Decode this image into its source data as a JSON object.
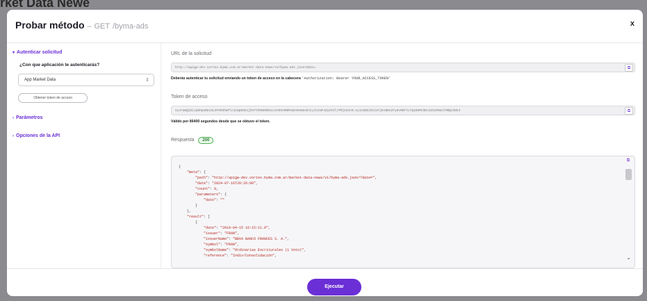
{
  "background": {
    "title": "rket Data Newe"
  },
  "header": {
    "title": "Probar método",
    "separator": "–",
    "method": "GET",
    "path": "/byma-ads",
    "close": "x"
  },
  "sidebar": {
    "auth_label": "Autenticar solicitud",
    "question": "¿Con que aplicación te autenticarás?",
    "app_value": "App Market Data",
    "token_button": "Obtener token de acceso",
    "params_label": "Parámetros",
    "api_options_label": "Opciones de la API"
  },
  "main": {
    "url_label": "URL de la solicitud",
    "url_value": "http://apigw-dev.vortex.byma.com.ar/market-data-news/v1/byma-ads.json?date=",
    "auth_help": "Deberás autenticar tu solicitud enviando un token de acceso en la cabecera",
    "auth_code": "'Authorization: Bearer YOUR_ACCESS_TOKEN'",
    "token_label": "Token de acceso",
    "token_value": "eyJraWQiOiJpbHpaNUJ3LXFOOXhWTlc4LWpDSG1jbVYtRVBXRE5oc2V6SnRNRVdwYmVWenNlcyIsImFsZyI6IlJTMjU2In0.eyJzdWIiOiI4YjExNDA3Yy0xMDFlLTQ4ZmMtODc3ZS1hNmJlMDQzZDk4",
    "token_validity": "Válido por 86400 segundos desde que se obtuvo el token.",
    "response_label": "Respuesta",
    "status_code": "200",
    "run_button": "Ejecutar"
  },
  "response_lines": [
    "{",
    "    \"meta\": {",
    "        \"path\": \"http://apigw-dev.vortex.byma.com.ar/market-data-news/v1/byma-ads.json/?date=\",",
    "        \"date\": \"2024-07-16T20:26:00\",",
    "        \"count\": 9,",
    "        \"parameters\": {",
    "            \"date\": \"\"",
    "        }",
    "    },",
    "    \"result\": [",
    "        {",
    "            \"date\": \"2019-04-15 16:15:11.0\",",
    "            \"issuer\": \"FRAN\",",
    "            \"issuerName\": \"BBVA BANCO FRANCES S. A.\",",
    "            \"symbol\": \"FRAN\",",
    "            \"symbolName\": \"Ordinarias Escriturales (1 Voto)\",",
    "            \"reference\": \"Indiv/Consolidación\","
  ],
  "icons": {
    "copy": "copy-icon",
    "close": "close-icon",
    "chevron": "chevron-down-icon"
  },
  "colors": {
    "accent": "#6b2fd6",
    "success": "#4caf50",
    "json_key": "#b3261e"
  }
}
